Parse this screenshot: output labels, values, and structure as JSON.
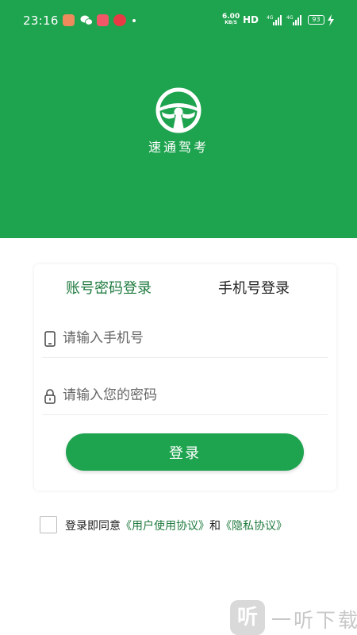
{
  "status_bar": {
    "time": "23:16",
    "net_speed_value": "6.00",
    "net_speed_unit": "KB/S",
    "hd_label": "HD",
    "signal_1_label": "4G",
    "signal_2_label": "4G",
    "battery_level": "93"
  },
  "colors": {
    "brand_green": "#1ea34f",
    "link_green": "#1e7a3e"
  },
  "brand": {
    "logo_icon": "steering-wheel-icon",
    "name": "速通驾考"
  },
  "login_card": {
    "tabs": [
      {
        "label": "账号密码登录",
        "selected": true
      },
      {
        "label": "手机号登录",
        "selected": false
      }
    ],
    "phone_field": {
      "icon": "phone-icon",
      "placeholder": "请输入手机号",
      "value": ""
    },
    "password_field": {
      "icon": "lock-icon",
      "placeholder": "请输入您的密码",
      "value": ""
    },
    "login_button": "登录"
  },
  "agreement": {
    "checked": false,
    "prefix": "登录即同意",
    "user_agreement": "《用户使用协议》",
    "conjunction": "和",
    "privacy_agreement": "《隐私协议》"
  },
  "watermark": {
    "icon_char": "听",
    "text": "一听下载"
  }
}
